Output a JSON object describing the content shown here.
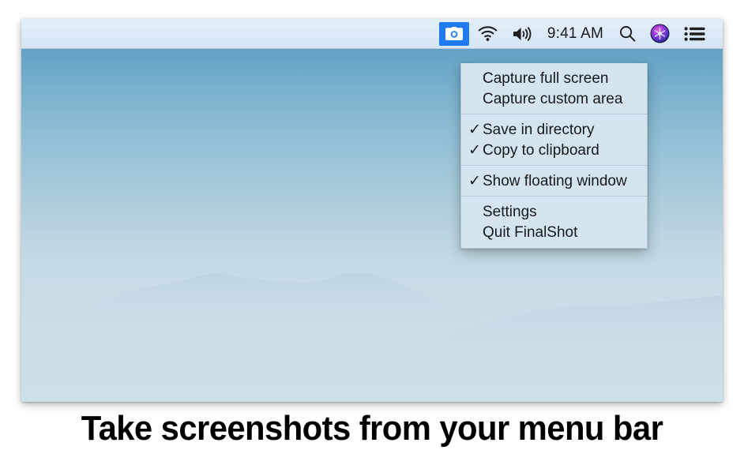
{
  "caption": "Take screenshots from your menu bar",
  "menu_bar": {
    "items": [
      {
        "name": "camera-icon",
        "label": "Screenshot",
        "highlighted": true,
        "accent": "#1e7cf0"
      },
      {
        "name": "wifi-icon",
        "label": "Wi-Fi",
        "highlighted": false
      },
      {
        "name": "volume-icon",
        "label": "Volume",
        "highlighted": false
      },
      {
        "name": "clock",
        "label": "9:41 AM",
        "highlighted": false
      },
      {
        "name": "search-icon",
        "label": "Spotlight Search",
        "highlighted": false
      },
      {
        "name": "siri-icon",
        "label": "Siri",
        "highlighted": false
      },
      {
        "name": "control-center-icon",
        "label": "Control Center",
        "highlighted": false
      }
    ],
    "clock": "9:41 AM"
  },
  "capture_menu": {
    "groups": [
      {
        "items": [
          {
            "label": "Capture full screen",
            "checked": false
          },
          {
            "label": "Capture custom area",
            "checked": false
          }
        ]
      },
      {
        "items": [
          {
            "label": "Save in directory",
            "checked": true
          },
          {
            "label": "Copy to clipboard",
            "checked": true
          }
        ]
      },
      {
        "items": [
          {
            "label": "Show floating window",
            "checked": true
          }
        ]
      },
      {
        "items": [
          {
            "label": "Settings",
            "checked": false
          },
          {
            "label": "Quit FinalShot",
            "checked": false
          }
        ]
      }
    ],
    "checkmark_glyph": "✓"
  },
  "colors": {
    "menu_bar_bg": "#dce9f6",
    "menu_bg": "#d4e5ef",
    "menu_text": "#16191c",
    "accent_blue": "#1e7cf0",
    "separator": "#b4ccd9",
    "wallpaper_sky_top": "#4f94bf",
    "wallpaper_fog": "#ccdee6",
    "ridge": "#6875c8"
  }
}
